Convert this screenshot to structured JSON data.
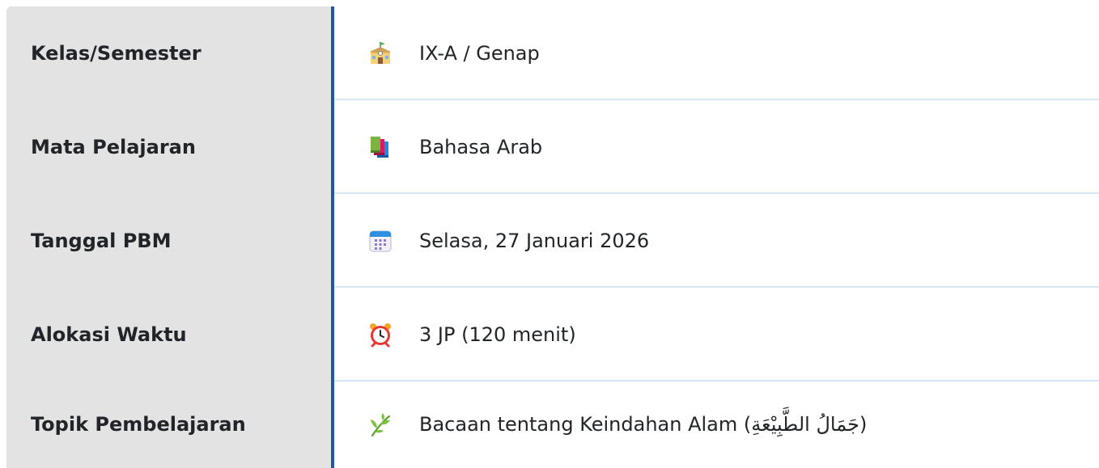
{
  "rows": [
    {
      "label": "Kelas/Semester",
      "icon": "school-icon",
      "value": "IX-A / Genap"
    },
    {
      "label": "Mata Pelajaran",
      "icon": "books-icon",
      "value": "Bahasa Arab"
    },
    {
      "label": "Tanggal PBM",
      "icon": "calendar-icon",
      "value": "Selasa, 27 Januari 2026"
    },
    {
      "label": "Alokasi Waktu",
      "icon": "alarm-clock-icon",
      "value": "3 JP (120 menit)"
    },
    {
      "label": "Topik Pembelajaran",
      "icon": "herb-icon",
      "value": "Bacaan tentang Keindahan Alam (جَمَالُ الطَّبِيْعَةِ)"
    }
  ],
  "colors": {
    "label_bg": "#e3e3e3",
    "divider": "#1f5a99",
    "row_separator": "#d6e6f5",
    "text": "#212529"
  }
}
